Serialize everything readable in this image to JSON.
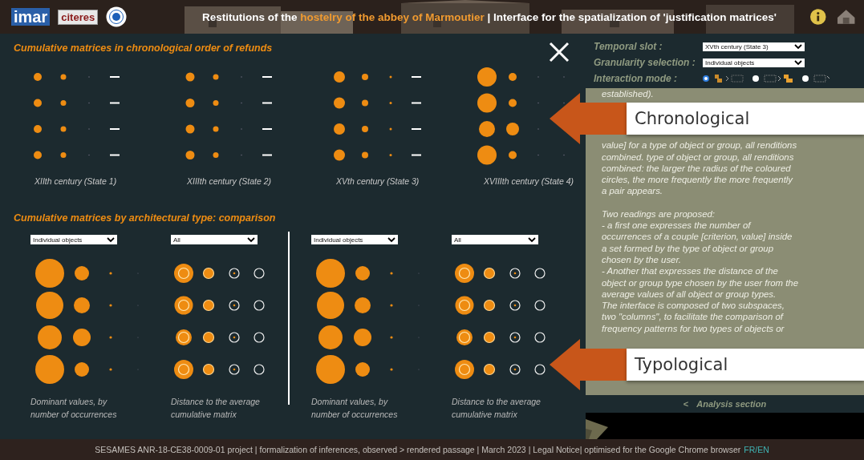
{
  "header": {
    "logos": [
      "imar",
      "citeres"
    ],
    "title_before": "Restitutions of the ",
    "title_highlight": "hostelry of the abbey of Marmoutier",
    "title_after": " | Interface for the spatialization of 'justification matrices'"
  },
  "chronological": {
    "title": "Cumulative matrices in chronological order of refunds",
    "matrices": [
      {
        "label": "XIIth century (State 1)"
      },
      {
        "label": "XIIIth century (State 2)"
      },
      {
        "label": "XVth century (State 3)"
      },
      {
        "label": "XVIIIth century (State 4)"
      }
    ]
  },
  "typological": {
    "title": "Cumulative matrices by architectural type: comparison",
    "columns": [
      {
        "kind": "dominant",
        "select": "Individual objects",
        "caption": [
          "Dominant values, by",
          "number of occurrences"
        ]
      },
      {
        "kind": "distance",
        "select": "All",
        "caption": [
          "Distance to the average",
          "cumulative matrix"
        ]
      },
      {
        "kind": "dominant",
        "select": "Individual objects",
        "caption": [
          "Dominant values, by",
          "number of occurrences"
        ]
      },
      {
        "kind": "distance",
        "select": "All",
        "caption": [
          "Distance to the average",
          "cumulative matrix"
        ]
      }
    ]
  },
  "controls": {
    "temporal_label": "Temporal slot :",
    "temporal_value": "XVth century (State 3)",
    "granularity_label": "Granularity selection :",
    "granularity_value": "Individual objects",
    "interaction_label": "Interaction mode :",
    "modes": [
      {
        "selected": true
      },
      {
        "selected": false
      },
      {
        "selected": false
      }
    ]
  },
  "description": [
    {
      "kind": "text",
      "lines": [
        "established)."
      ]
    },
    {
      "kind": "callout",
      "label": "Chronological"
    },
    {
      "kind": "text",
      "lines": [
        "value] for a type of object or group, all renditions",
        "combined. type of object or group, all renditions",
        "combined: the larger the radius of the coloured",
        "circles, the more frequently the more frequently",
        "a pair appears."
      ]
    },
    {
      "kind": "text",
      "lines": [
        "Two readings are proposed:",
        "- a first one expresses the number of",
        "occurrences of a couple [criterion, value] inside",
        "a set formed by the type of object or group",
        "chosen by the user.",
        "- Another that expresses the distance of the",
        "object or group type chosen by the user from the",
        "average values of all object or group types.",
        "The interface is composed of two subspaces,",
        "two \"columns\", to facilitate the comparison of",
        "frequency patterns for two types of objects or"
      ]
    },
    {
      "kind": "callout",
      "label": "Typological"
    }
  ],
  "analysis": {
    "arrow": "<",
    "label": "Analysis section"
  },
  "footer": {
    "text": "SESAMES ANR-18-CE38-0009-01 project | formalization of inferences, observed > rendered passage | March 2023 | Legal Notice| optimised for the Google Chrome browser",
    "link": "FR/EN"
  }
}
